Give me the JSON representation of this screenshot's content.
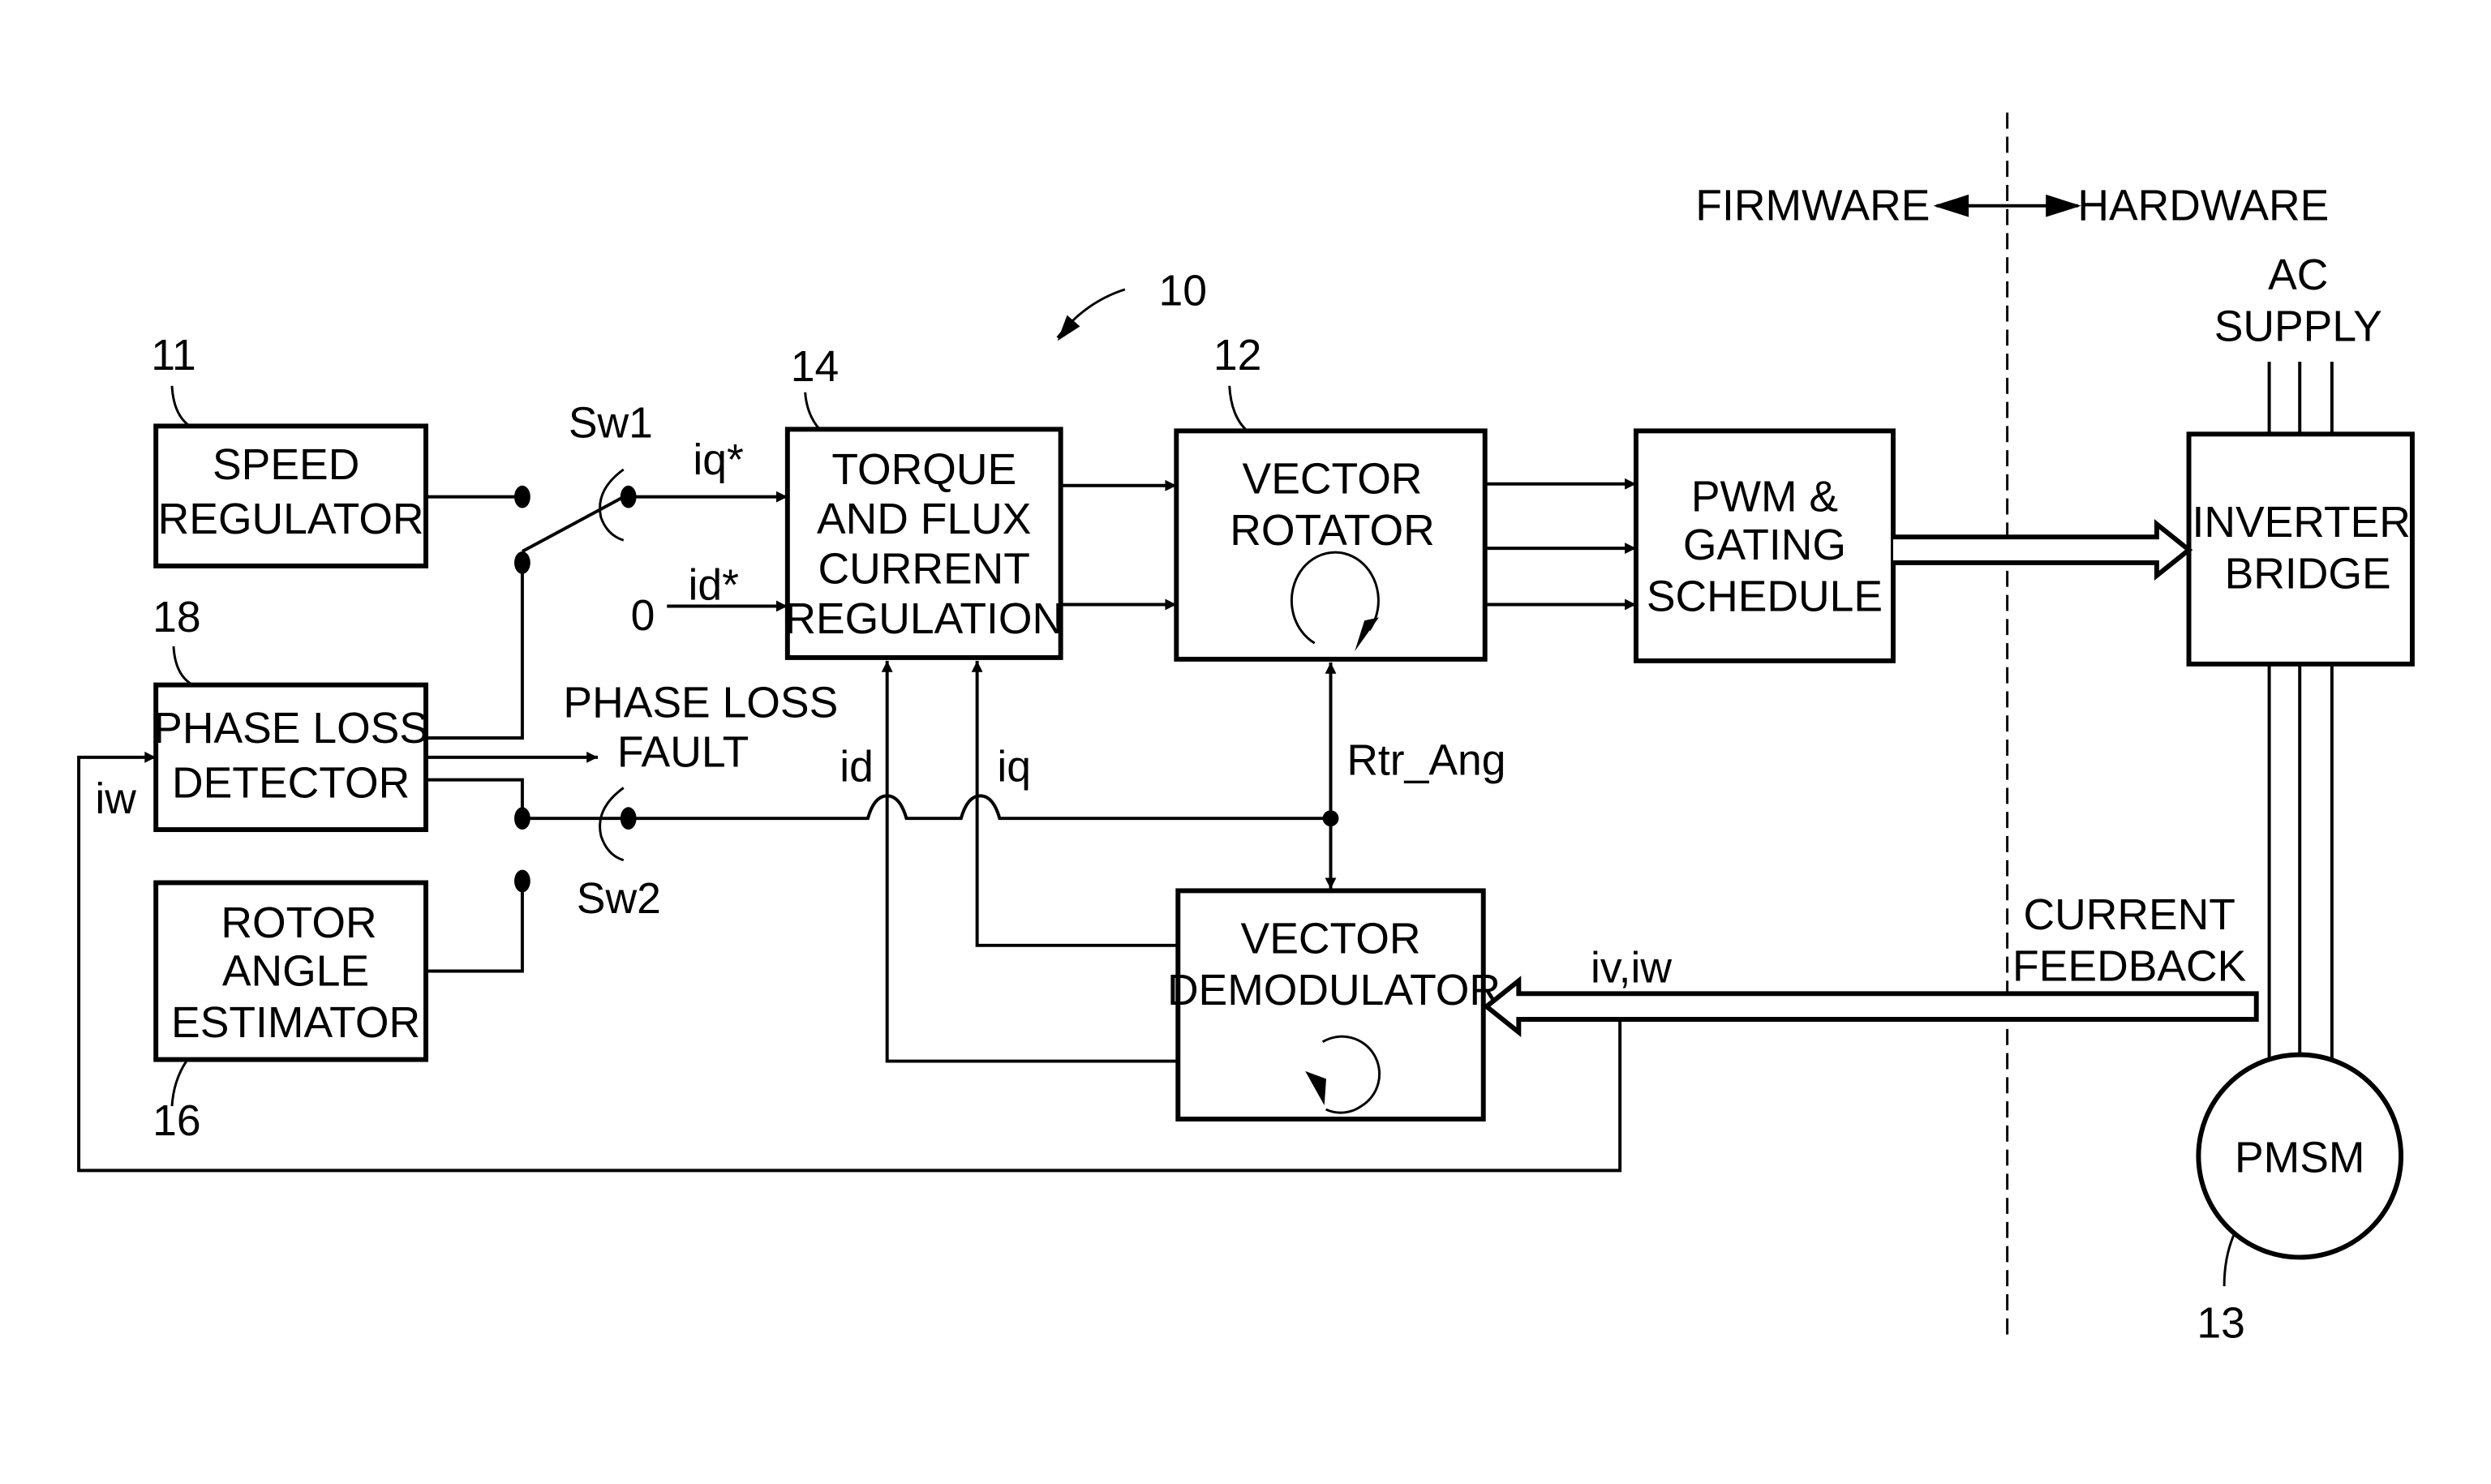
{
  "diagram": {
    "reference_number": "10",
    "partition": {
      "left_label": "FIRMWARE",
      "right_label": "HARDWARE"
    },
    "blocks": {
      "speed_regulator": {
        "ref": "11",
        "lines": [
          "SPEED",
          "REGULATOR"
        ]
      },
      "phase_loss_detector": {
        "ref": "18",
        "lines": [
          "PHASE  LOSS",
          "DETECTOR"
        ]
      },
      "rotor_angle_estimator": {
        "ref": "16",
        "lines": [
          "ROTOR",
          "ANGLE",
          "ESTIMATOR"
        ]
      },
      "torque_flux_regulation": {
        "ref": "14",
        "lines": [
          "TORQUE",
          "AND  FLUX",
          "CURRENT",
          "REGULATION"
        ]
      },
      "vector_rotator": {
        "ref": "12",
        "lines": [
          "VECTOR",
          "ROTATOR"
        ]
      },
      "vector_demodulator": {
        "lines": [
          "VECTOR",
          "DEMODULATOR"
        ]
      },
      "pwm_gating": {
        "lines": [
          "PWM  &",
          "GATING",
          "SCHEDULE"
        ]
      },
      "inverter_bridge": {
        "lines": [
          "INVERTER",
          "BRIDGE"
        ]
      },
      "pmsm": {
        "ref": "13",
        "label": "PMSM"
      }
    },
    "signals": {
      "sw1": "Sw1",
      "sw2": "Sw2",
      "iq_ref": "iq*",
      "id_ref": "id*",
      "zero": "0",
      "phase_loss_fault": [
        "PHASE  LOSS",
        "FAULT"
      ],
      "id": "id",
      "iq": "iq",
      "iw": "iw",
      "rtr_ang": "Rtr_Ang",
      "iv_iw": "iv,iw",
      "current_feedback": [
        "CURRENT",
        "FEEDBACK"
      ],
      "ac_supply": [
        "AC",
        "SUPPLY"
      ]
    }
  }
}
